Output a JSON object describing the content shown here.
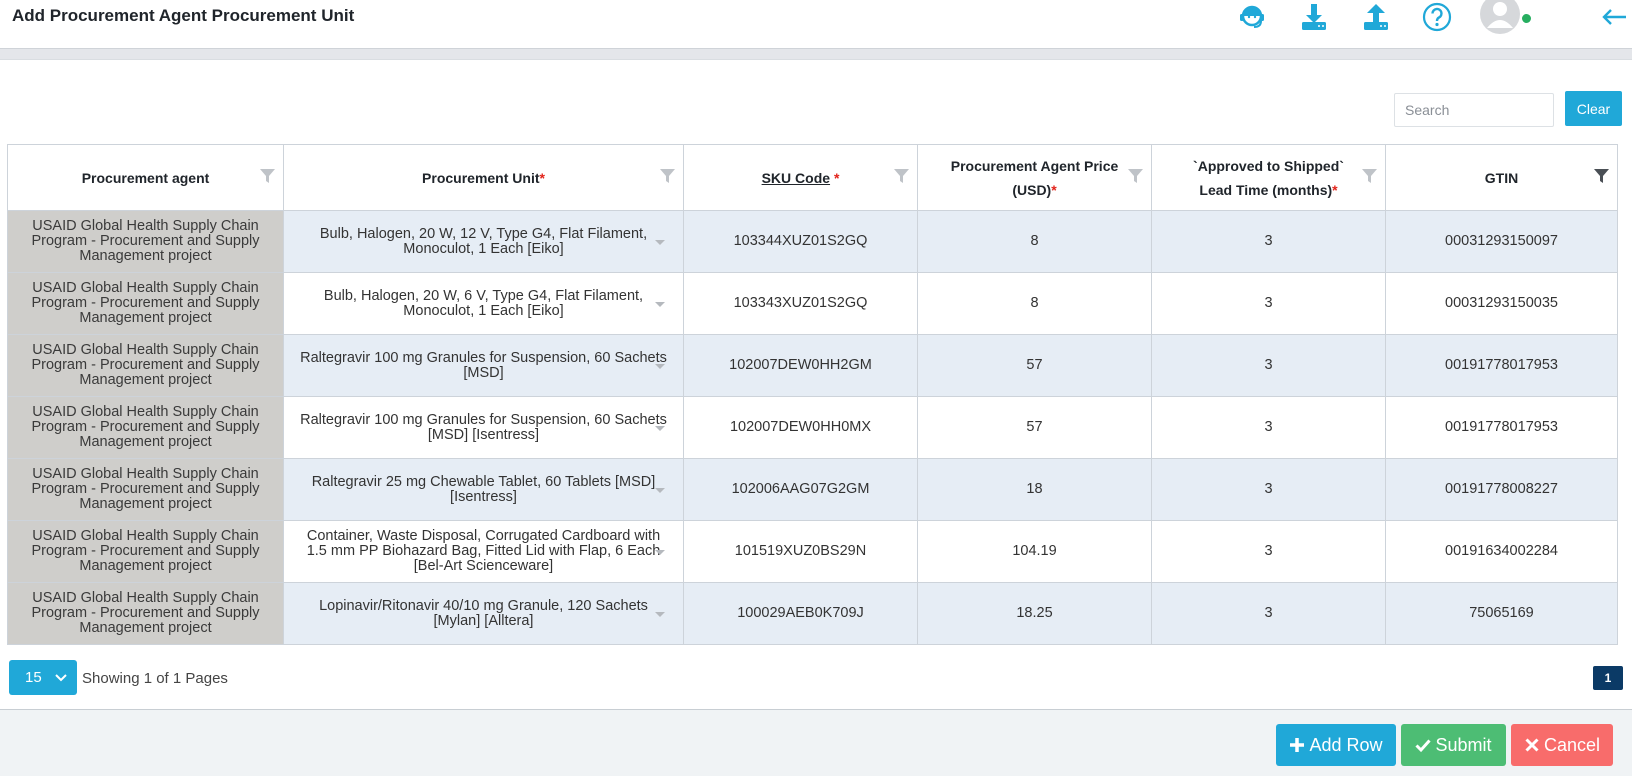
{
  "header": {
    "title": "Add Procurement Agent Procurement Unit",
    "icons": [
      "support-agent-icon",
      "download-icon",
      "upload-icon",
      "help-icon",
      "home-icon",
      "user-avatar-icon",
      "logout-icon"
    ]
  },
  "search": {
    "placeholder": "Search",
    "value": "",
    "clear_label": "Clear"
  },
  "table": {
    "columns": [
      {
        "label": "Procurement agent",
        "required": ""
      },
      {
        "label": "Procurement Unit",
        "required": "*"
      },
      {
        "label": "SKU Code",
        "required": "*"
      },
      {
        "label": "Procurement Agent Price (USD)",
        "required": "*"
      },
      {
        "label": "`Approved to Shipped` Lead Time (months)",
        "required": "*"
      },
      {
        "label": "GTIN",
        "required": ""
      }
    ],
    "rows": [
      {
        "agent": "USAID Global Health Supply Chain Program - Procurement and Supply Management project",
        "unit": "Bulb, Halogen, 20 W, 12 V, Type G4, Flat Filament, Monoculot, 1 Each [Eiko]",
        "sku": "103344XUZ01S2GQ",
        "price": "8",
        "lead": "3",
        "gtin": "00031293150097"
      },
      {
        "agent": "USAID Global Health Supply Chain Program - Procurement and Supply Management project",
        "unit": "Bulb, Halogen, 20 W, 6 V, Type G4, Flat Filament, Monoculot, 1 Each [Eiko]",
        "sku": "103343XUZ01S2GQ",
        "price": "8",
        "lead": "3",
        "gtin": "00031293150035"
      },
      {
        "agent": "USAID Global Health Supply Chain Program - Procurement and Supply Management project",
        "unit": "Raltegravir 100 mg Granules for Suspension, 60 Sachets [MSD]",
        "sku": "102007DEW0HH2GM",
        "price": "57",
        "lead": "3",
        "gtin": "00191778017953"
      },
      {
        "agent": "USAID Global Health Supply Chain Program - Procurement and Supply Management project",
        "unit": "Raltegravir 100 mg Granules for Suspension, 60 Sachets [MSD] [Isentress]",
        "sku": "102007DEW0HH0MX",
        "price": "57",
        "lead": "3",
        "gtin": "00191778017953"
      },
      {
        "agent": "USAID Global Health Supply Chain Program - Procurement and Supply Management project",
        "unit": "Raltegravir 25 mg Chewable Tablet, 60 Tablets [MSD] [Isentress]",
        "sku": "102006AAG07G2GM",
        "price": "18",
        "lead": "3",
        "gtin": "00191778008227"
      },
      {
        "agent": "USAID Global Health Supply Chain Program - Procurement and Supply Management project",
        "unit": "Container, Waste Disposal, Corrugated Cardboard with 1.5 mm PP Biohazard Bag, Fitted Lid with Flap, 6 Each [Bel-Art Scienceware]",
        "sku": "101519XUZ0BS29N",
        "price": "104.19",
        "lead": "3",
        "gtin": "00191634002284"
      },
      {
        "agent": "USAID Global Health Supply Chain Program - Procurement and Supply Management project",
        "unit": "Lopinavir/Ritonavir 40/10 mg Granule, 120 Sachets [Mylan] [Alltera]",
        "sku": "100029AEB0K709J",
        "price": "18.25",
        "lead": "3",
        "gtin": "75065169"
      }
    ]
  },
  "pagination": {
    "page_size": "15",
    "showing": "Showing 1 of 1 Pages",
    "current_page": "1"
  },
  "footer": {
    "add_row_label": "Add Row",
    "submit_label": "Submit",
    "cancel_label": "Cancel"
  },
  "colors": {
    "primary": "#20a8d8",
    "success": "#4dbd74",
    "danger": "#f86c6b",
    "page_active": "#0b3a66",
    "agent_cell": "#cfcecb",
    "odd_row": "#e6edf5"
  }
}
